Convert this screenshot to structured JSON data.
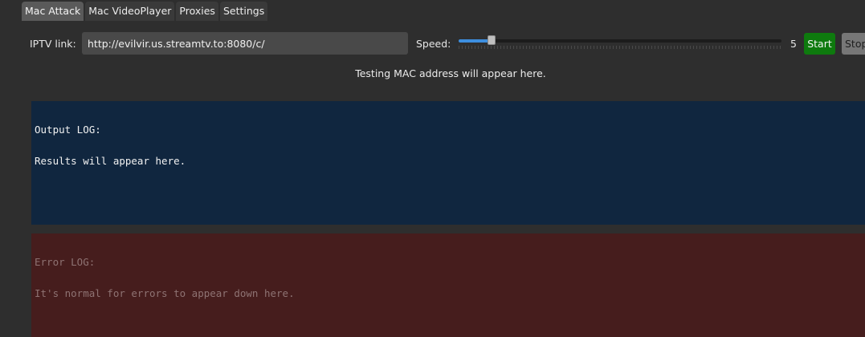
{
  "tabs": [
    {
      "label": "Mac Attack",
      "active": true
    },
    {
      "label": "Mac VideoPlayer",
      "active": false
    },
    {
      "label": "Proxies",
      "active": false
    },
    {
      "label": "Settings",
      "active": false
    }
  ],
  "controls": {
    "iptv_label": "IPTV link:",
    "iptv_value": "http://evilvir.us.streamtv.to:8080/c/",
    "speed_label": "Speed:",
    "speed_value": "5",
    "speed_level": 0.05,
    "start_label": "Start",
    "stop_label": "Stop"
  },
  "status": {
    "testing_mac": "Testing MAC address will appear here."
  },
  "output_log": {
    "title": "Output LOG:",
    "body": "Results will appear here."
  },
  "error_log": {
    "title": "Error LOG:",
    "body": "It's normal for errors to appear down here."
  },
  "colors": {
    "background": "#2e2e2e",
    "output_log_bg": "#10263f",
    "error_log_bg": "#461d1d",
    "start_button": "#0e7a0e",
    "stop_button": "#777777",
    "slider_accent": "#3d8fe0"
  }
}
